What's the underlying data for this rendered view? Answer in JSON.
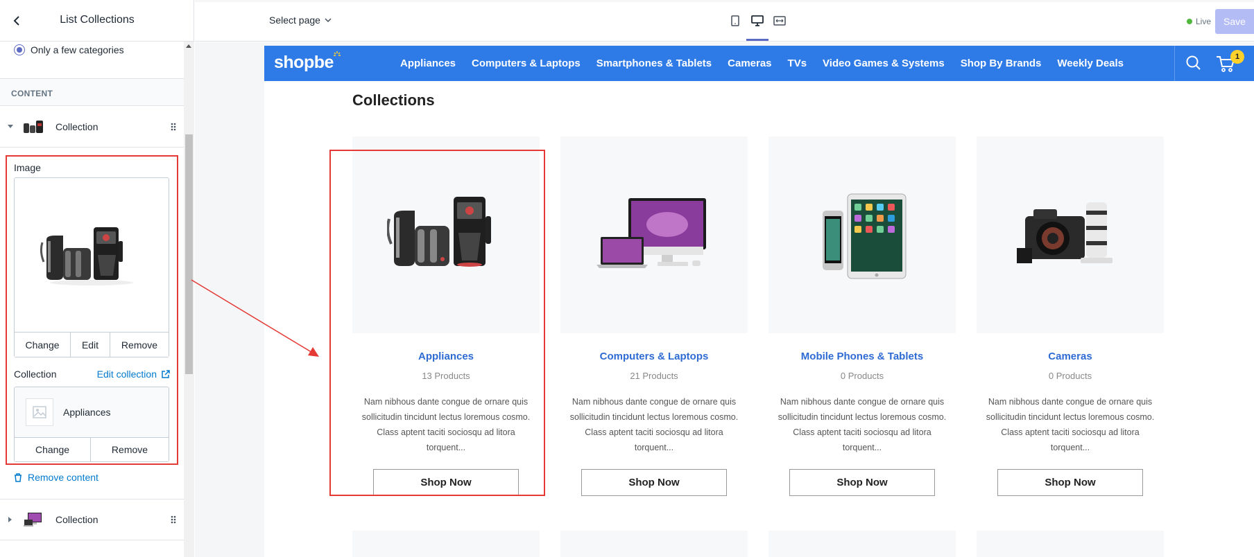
{
  "sidebar": {
    "title": "List Collections",
    "radio_option": "Only a few categories",
    "section_label": "CONTENT",
    "blocks": [
      {
        "label": "Collection"
      },
      {
        "label": "Collection"
      }
    ],
    "image_label": "Image",
    "image_buttons": [
      "Change",
      "Edit",
      "Remove"
    ],
    "collection_label": "Collection",
    "edit_collection": "Edit collection",
    "collection_value": "Appliances",
    "collection_buttons": [
      "Change",
      "Remove"
    ],
    "remove_content": "Remove content"
  },
  "topbar": {
    "select_page": "Select page",
    "live": "Live",
    "save": "Save"
  },
  "site": {
    "logo": "shopbe",
    "nav": [
      "Appliances",
      "Computers & Laptops",
      "Smartphones & Tablets",
      "Cameras",
      "TVs",
      "Video Games & Systems",
      "Shop By Brands",
      "Weekly Deals"
    ],
    "cart_count": "1",
    "heading": "Collections",
    "cards": [
      {
        "title": "Appliances",
        "count": "13 Products",
        "desc": "Nam nibhous dante congue de ornare quis sollicitudin tincidunt lectus loremous cosmo. Class aptent taciti sociosqu ad litora torquent...",
        "button": "Shop Now"
      },
      {
        "title": "Computers & Laptops",
        "count": "21 Products",
        "desc": "Nam nibhous dante congue de ornare quis sollicitudin tincidunt lectus loremous cosmo. Class aptent taciti sociosqu ad litora torquent...",
        "button": "Shop Now"
      },
      {
        "title": "Mobile Phones & Tablets",
        "count": "0 Products",
        "desc": "Nam nibhous dante congue de ornare quis sollicitudin tincidunt lectus loremous cosmo. Class aptent taciti sociosqu ad litora torquent...",
        "button": "Shop Now"
      },
      {
        "title": "Cameras",
        "count": "0 Products",
        "desc": "Nam nibhous dante congue de ornare quis sollicitudin tincidunt lectus loremous cosmo. Class aptent taciti sociosqu ad litora torquent...",
        "button": "Shop Now"
      }
    ]
  },
  "colors": {
    "accent": "#5c6ac4",
    "nav_bg": "#2e7ae6",
    "link": "#007ace",
    "annotation": "#e53935",
    "badge": "#ffd12a"
  }
}
